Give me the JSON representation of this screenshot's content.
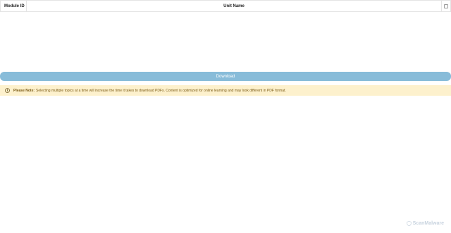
{
  "table": {
    "headers": {
      "module_id": "Module ID",
      "unit_name": "Unit Name"
    },
    "select_all_checked": false
  },
  "download_button": {
    "label": "Download"
  },
  "note": {
    "title": "Please Note:",
    "text": "Selecting multiple topics at a time will increase the time it takes to download PDFs. Content is optimized for online learning and may look different in PDF format.",
    "icon": "info-circle-icon"
  },
  "watermark": {
    "text": "ScanMalware",
    "icon": "shield-icon"
  },
  "colors": {
    "download_button": "#88bcd9",
    "note_background": "#fdf1cd",
    "note_text": "#7a5a14"
  }
}
